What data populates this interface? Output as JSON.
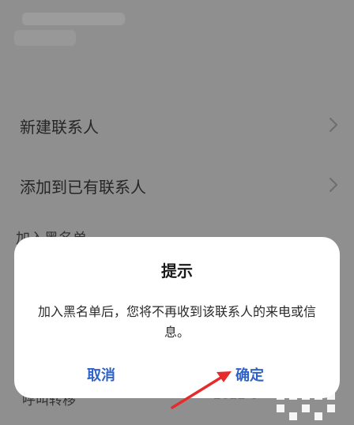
{
  "menu": {
    "new_contact": "新建联系人",
    "add_to_existing": "添加到已有联系人",
    "chevron_icon": "chevron-right-icon"
  },
  "partial": {
    "obscured_item": "加入黑名单"
  },
  "footer": {
    "left_text": "呼叫转移",
    "right_text": "2022-0"
  },
  "dialog": {
    "title": "提示",
    "message": "加入黑名单后，您将不再收到该联系人的来电或信息。",
    "cancel_label": "取消",
    "confirm_label": "确定"
  },
  "colors": {
    "overlay_bg": "#8f8f8f",
    "dialog_bg": "#ffffff",
    "accent_blue": "#2e62c9",
    "arrow_red": "#e52b2b"
  }
}
